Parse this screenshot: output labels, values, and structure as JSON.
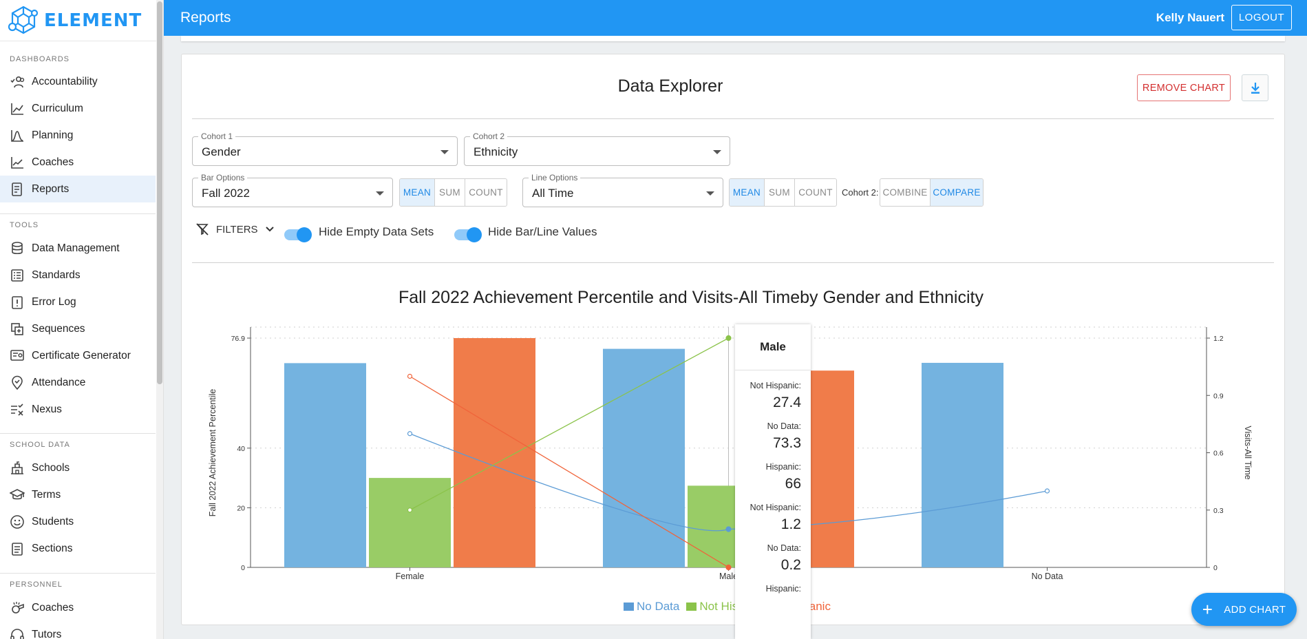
{
  "app": {
    "logo_text": "ELEMENT",
    "brand_color": "#2196f3"
  },
  "sidebar": {
    "sections": [
      {
        "label": "DASHBOARDS",
        "items": [
          {
            "label": "Accountability",
            "icon": "people-check-icon"
          },
          {
            "label": "Curriculum",
            "icon": "line-chart-icon"
          },
          {
            "label": "Planning",
            "icon": "bell-curve-icon"
          },
          {
            "label": "Coaches",
            "icon": "trend-chart-icon"
          },
          {
            "label": "Reports",
            "icon": "report-icon",
            "active": true
          }
        ]
      },
      {
        "label": "TOOLS",
        "items": [
          {
            "label": "Data Management",
            "icon": "database-icon"
          },
          {
            "label": "Standards",
            "icon": "list-icon"
          },
          {
            "label": "Error Log",
            "icon": "clipboard-alert-icon"
          },
          {
            "label": "Sequences",
            "icon": "sequence-icon"
          },
          {
            "label": "Certificate Generator",
            "icon": "certificate-icon"
          },
          {
            "label": "Attendance",
            "icon": "map-pin-check-icon"
          },
          {
            "label": "Nexus",
            "icon": "list-check-icon"
          }
        ]
      },
      {
        "label": "SCHOOL DATA",
        "items": [
          {
            "label": "Schools",
            "icon": "school-icon"
          },
          {
            "label": "Terms",
            "icon": "graduation-cap-icon"
          },
          {
            "label": "Students",
            "icon": "smiley-icon"
          },
          {
            "label": "Sections",
            "icon": "clipboard-list-icon"
          }
        ]
      },
      {
        "label": "PERSONNEL",
        "items": [
          {
            "label": "Coaches",
            "icon": "whistle-icon"
          },
          {
            "label": "Tutors",
            "icon": "headset-icon"
          }
        ]
      }
    ]
  },
  "header": {
    "title": "Reports",
    "user_name": "Kelly Nauert",
    "logout_label": "LOGOUT"
  },
  "explorer": {
    "title": "Data Explorer",
    "remove_chart_label": "REMOVE CHART",
    "download_icon": "download-icon",
    "cohort1": {
      "label": "Cohort 1",
      "value": "Gender"
    },
    "cohort2": {
      "label": "Cohort 2",
      "value": "Ethnicity"
    },
    "bar_options": {
      "label": "Bar Options",
      "value": "Fall 2022",
      "modes": [
        "MEAN",
        "SUM",
        "COUNT"
      ],
      "selected": "MEAN"
    },
    "line_options": {
      "label": "Line Options",
      "value": "All Time",
      "modes": [
        "MEAN",
        "SUM",
        "COUNT"
      ],
      "selected": "MEAN"
    },
    "cohort2_mode": {
      "label": "Cohort 2:",
      "modes": [
        "COMBINE",
        "COMPARE"
      ],
      "selected": "COMPARE"
    },
    "filters_label": "FILTERS",
    "toggles": [
      {
        "label": "Hide Empty Data Sets",
        "on": true
      },
      {
        "label": "Hide Bar/Line Values",
        "on": true
      }
    ],
    "add_chart_label": "ADD CHART"
  },
  "tooltip": {
    "title": "Male",
    "rows": [
      {
        "key": "Not Hispanic:",
        "value": "27.4"
      },
      {
        "key": "No Data:",
        "value": "73.3"
      },
      {
        "key": "Hispanic:",
        "value": "66"
      },
      {
        "key": "Not Hispanic:",
        "value": "1.2"
      },
      {
        "key": "No Data:",
        "value": "0.2"
      },
      {
        "key": "Hispanic:",
        "value": ""
      }
    ]
  },
  "chart_data": {
    "type": "bar",
    "title": "Fall 2022 Achievement Percentile and Visits-All Timeby Gender and Ethnicity",
    "categories": [
      "Female",
      "Male",
      "No Data"
    ],
    "ylabel": "Fall 2022 Achievement Percentile",
    "y2label": "Visits-All Time",
    "ylim": [
      0,
      76.9
    ],
    "y_ticks": [
      "0",
      "20",
      "40",
      "76.9"
    ],
    "y2lim": [
      0,
      1.2
    ],
    "y2_ticks": [
      "0",
      "0.3",
      "0.6",
      "0.9",
      "1.2"
    ],
    "grid": true,
    "bar_series": [
      {
        "name": "No Data",
        "color": "#74b3e0",
        "values": [
          68.5,
          73.3,
          68.6
        ]
      },
      {
        "name": "Not Hispanic",
        "color": "#99cc66",
        "values": [
          30.0,
          27.4,
          null
        ]
      },
      {
        "name": "Hispanic",
        "color": "#f07c4a",
        "values": [
          76.9,
          66,
          null
        ]
      }
    ],
    "line_series": [
      {
        "name": "No Data",
        "color": "#5b9bd5",
        "values": [
          0.7,
          0.2,
          0.4
        ]
      },
      {
        "name": "Not Hispanic",
        "color": "#8bc34a",
        "values": [
          0.3,
          1.2,
          null
        ]
      },
      {
        "name": "Hispanic",
        "color": "#f0643a",
        "values": [
          1.0,
          0.0,
          null
        ]
      }
    ],
    "legend": {
      "position": "bottom",
      "items": [
        {
          "name": "No Data",
          "color": "#5b9bd5"
        },
        {
          "name": "Not Hispanic",
          "color": "#8bc34a"
        },
        {
          "name": "Hispanic",
          "color": "#f0643a"
        }
      ]
    }
  }
}
